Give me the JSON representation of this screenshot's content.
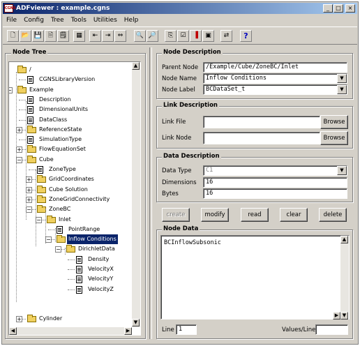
{
  "window": {
    "title": "ADFviewer : example.cgns",
    "minimize": "_",
    "maximize": "□",
    "close": "×",
    "icon_text": "CGNS"
  },
  "menu": [
    "File",
    "Config",
    "Tree",
    "Tools",
    "Utilities",
    "Help"
  ],
  "toolbar": {
    "tools": [
      {
        "name": "new-file-icon",
        "glyph": "🗋"
      },
      {
        "name": "open-folder-icon",
        "glyph": "📂"
      },
      {
        "name": "save-icon",
        "glyph": "💾"
      },
      {
        "name": "save-as-icon",
        "glyph": "🗎"
      },
      {
        "name": "properties-icon",
        "glyph": "🗒"
      },
      {
        "name": "table-icon",
        "glyph": "▦"
      },
      {
        "name": "move-left-icon",
        "glyph": "⇤"
      },
      {
        "name": "move-right-icon",
        "glyph": "⇥"
      },
      {
        "name": "link-icon",
        "glyph": "⇔"
      },
      {
        "name": "find-icon",
        "glyph": "🔍"
      },
      {
        "name": "find-next-icon",
        "glyph": "🔎"
      },
      {
        "name": "copy-icon",
        "glyph": "⎘"
      },
      {
        "name": "check-icon",
        "glyph": "☑"
      },
      {
        "name": "chart-icon",
        "glyph": "▐"
      },
      {
        "name": "select-icon",
        "glyph": "▣"
      },
      {
        "name": "compare-icon",
        "glyph": "⇄"
      },
      {
        "name": "help-icon",
        "glyph": "?"
      }
    ]
  },
  "node_tree": {
    "title": "Node Tree",
    "rows": [
      {
        "label": "/",
        "icon": "folder",
        "level": 0,
        "expander": ""
      },
      {
        "label": "CGNSLibraryVersion",
        "icon": "doc",
        "level": 1,
        "expander": ""
      },
      {
        "label": "Example",
        "icon": "folder",
        "level": 0,
        "expander": "−"
      },
      {
        "label": "Description",
        "icon": "doc",
        "level": 1,
        "expander": ""
      },
      {
        "label": "DimensionalUnits",
        "icon": "doc",
        "level": 1,
        "expander": ""
      },
      {
        "label": "DataClass",
        "icon": "doc",
        "level": 1,
        "expander": ""
      },
      {
        "label": "ReferenceState",
        "icon": "folder",
        "level": 1,
        "expander": "+"
      },
      {
        "label": "SimulationType",
        "icon": "doc",
        "level": 1,
        "expander": ""
      },
      {
        "label": "FlowEquationSet",
        "icon": "folder",
        "level": 1,
        "expander": "+"
      },
      {
        "label": "Cube",
        "icon": "folder",
        "level": 1,
        "expander": "−"
      },
      {
        "label": "ZoneType",
        "icon": "doc",
        "level": 2,
        "expander": ""
      },
      {
        "label": "GridCoordinates",
        "icon": "folder",
        "level": 2,
        "expander": "+"
      },
      {
        "label": "Cube Solution",
        "icon": "folder",
        "level": 2,
        "expander": "+"
      },
      {
        "label": "ZoneGridConnectivity",
        "icon": "folder",
        "level": 2,
        "expander": "+"
      },
      {
        "label": "ZoneBC",
        "icon": "folder",
        "level": 2,
        "expander": "−"
      },
      {
        "label": "Inlet",
        "icon": "folder",
        "level": 3,
        "expander": "−"
      },
      {
        "label": "PointRange",
        "icon": "doc",
        "level": 4,
        "expander": ""
      },
      {
        "label": "Inflow Conditions",
        "icon": "folder",
        "level": 4,
        "expander": "−",
        "selected": true
      },
      {
        "label": "DirichletData",
        "icon": "folder",
        "level": 5,
        "expander": "−"
      },
      {
        "label": "Density",
        "icon": "doc",
        "level": 6,
        "expander": ""
      },
      {
        "label": "VelocityX",
        "icon": "doc",
        "level": 6,
        "expander": ""
      },
      {
        "label": "VelocityY",
        "icon": "doc",
        "level": 6,
        "expander": ""
      },
      {
        "label": "VelocityZ",
        "icon": "doc",
        "level": 6,
        "expander": ""
      },
      {
        "label": "Cylinder",
        "icon": "folder",
        "level": 1,
        "expander": "+",
        "gap_before": true
      }
    ]
  },
  "node_description": {
    "title": "Node Description",
    "parent_label": "Parent Node",
    "parent_value": "/Example/Cube/ZoneBC/Inlet",
    "name_label": "Node Name",
    "name_value": "Inflow Conditions",
    "node_label_label": "Node Label",
    "node_label_value": "BCDataSet_t"
  },
  "link_description": {
    "title": "Link Description",
    "file_label": "Link File",
    "file_value": "",
    "file_browse": "Browse",
    "node_label": "Link Node",
    "node_value": "",
    "node_browse": "Browse"
  },
  "data_description": {
    "title": "Data Description",
    "type_label": "Data Type",
    "type_value": "C1",
    "dimensions_label": "Dimensions",
    "dimensions_value": "16",
    "bytes_label": "Bytes",
    "bytes_value": "16"
  },
  "actions": {
    "create": "create",
    "modify": "modify",
    "read": "read",
    "clear": "clear",
    "delete": "delete"
  },
  "node_data": {
    "title": "Node Data",
    "content": "BCInflowSubsonic",
    "line_label": "Line",
    "line_value": "1",
    "values_label": "Values/Line",
    "values_value": ""
  }
}
